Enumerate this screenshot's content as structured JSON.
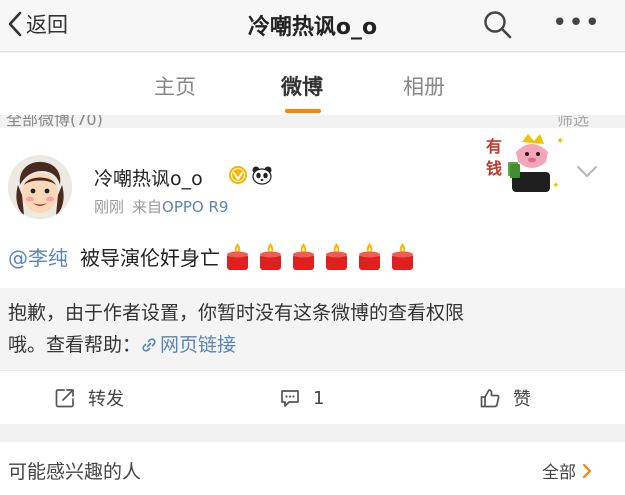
{
  "navbar": {
    "back_label": "返回",
    "title": "冷嘲热讽o_o",
    "more_label": "•••"
  },
  "tabs": [
    {
      "label": "主页",
      "active": false
    },
    {
      "label": "微博",
      "active": true
    },
    {
      "label": "相册",
      "active": false
    }
  ],
  "strip": {
    "left_text": "全部微博(70)",
    "right_text": "筛选"
  },
  "post": {
    "author": "冷嘲热讽o_o",
    "time": "刚刚",
    "source_prefix": "来自",
    "source": "OPPO R9",
    "mention": "@李纯",
    "text": "被导演伦奸身亡",
    "candle_count": 6,
    "notice_line1": "抱歉，由于作者设置，你暂时没有这条微博的查看权限",
    "notice_line2_prefix": "哦。查看帮助：",
    "help_link": "网页链接"
  },
  "actions": {
    "repost_label": "转发",
    "comment_count": "1",
    "like_label": "赞"
  },
  "suggest": {
    "title": "可能感兴趣的人",
    "all_label": "全部"
  },
  "colors": {
    "accent": "#ff8200",
    "link": "#5b84b8",
    "candle_red": "#e0201e",
    "flame": "#ffb400"
  },
  "icons": [
    "chevron-left-icon",
    "search-icon",
    "more-icon",
    "vip-badge-icon",
    "panda-icon",
    "chevron-down-icon",
    "link-icon",
    "repost-icon",
    "comment-icon",
    "like-icon",
    "chevron-right-icon",
    "candle-icon"
  ]
}
